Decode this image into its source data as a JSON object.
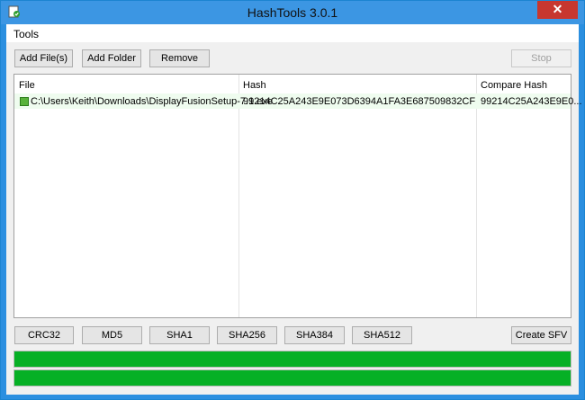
{
  "window": {
    "title": "HashTools 3.0.1",
    "close_glyph": "✕"
  },
  "menu": {
    "tools": "Tools"
  },
  "toolbar": {
    "add_files": "Add File(s)",
    "add_folder": "Add Folder",
    "remove": "Remove",
    "stop": "Stop"
  },
  "table": {
    "headers": {
      "file": "File",
      "hash": "Hash",
      "compare": "Compare Hash"
    },
    "rows": [
      {
        "file": "C:\\Users\\Keith\\Downloads\\DisplayFusionSetup-7.1.exe",
        "hash": "99214C25A243E9E073D6394A1FA3E687509832CF",
        "compare": "99214C25A243E9E0..."
      }
    ]
  },
  "hash_buttons": {
    "crc32": "CRC32",
    "md5": "MD5",
    "sha1": "SHA1",
    "sha256": "SHA256",
    "sha384": "SHA384",
    "sha512": "SHA512",
    "create_sfv": "Create SFV"
  },
  "progress": {
    "file_progress": 1.0,
    "total_progress": 1.0,
    "color": "#06b025"
  },
  "colors": {
    "titlebar": "#3c96e3",
    "close": "#c7372f",
    "row_highlight": "#effcef"
  }
}
